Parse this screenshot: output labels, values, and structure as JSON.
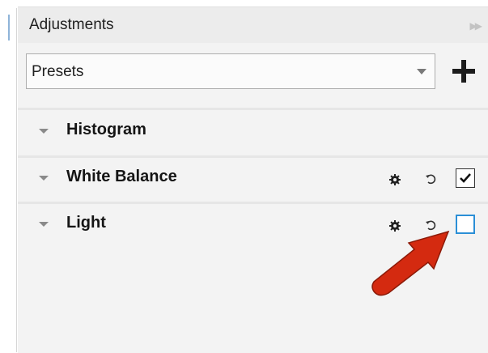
{
  "panel": {
    "title": "Adjustments",
    "collapse_icon": "double-chevron-right-icon"
  },
  "presets": {
    "value": "Presets",
    "add_icon": "plus-icon"
  },
  "sections": [
    {
      "label": "Histogram",
      "has_controls": false
    },
    {
      "label": "White Balance",
      "has_controls": true,
      "enabled": true
    },
    {
      "label": "Light",
      "has_controls": true,
      "enabled": false
    }
  ],
  "colors": {
    "accent": "#2b8fd6",
    "annotation_arrow": "#d42a10"
  }
}
